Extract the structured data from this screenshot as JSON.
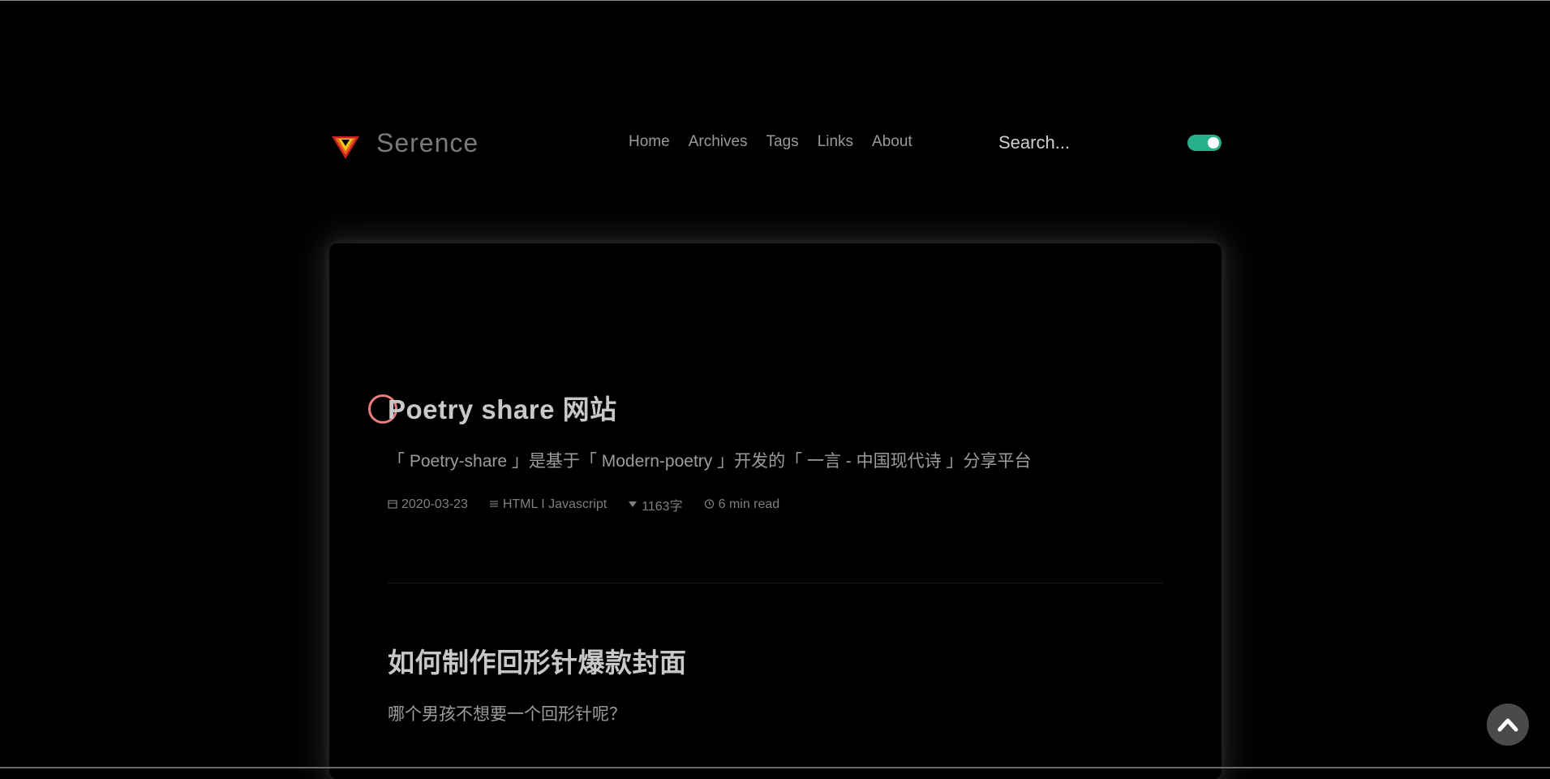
{
  "brand": {
    "name": "Serence",
    "logo_icon": "triangle-logo-icon",
    "logo_colors": [
      "#f5c518",
      "#e8641e",
      "#c42020"
    ]
  },
  "nav": {
    "items": [
      {
        "label": "Home"
      },
      {
        "label": "Archives"
      },
      {
        "label": "Tags"
      },
      {
        "label": "Links"
      },
      {
        "label": "About"
      }
    ]
  },
  "search": {
    "placeholder": "Search..."
  },
  "theme_toggle": {
    "state": "on",
    "color": "#27b08c"
  },
  "posts": [
    {
      "title": "Poetry share 网站",
      "description": "「 Poetry-share 」是基于「 Modern-poetry 」开发的「 一言 - 中国现代诗 」分享平台",
      "date": "2020-03-23",
      "categories": "HTML I Javascript",
      "word_count": "1163字",
      "read_time": "6 min read"
    },
    {
      "title": "如何制作回形针爆款封面",
      "description": "哪个男孩不想要一个回形针呢？"
    }
  ],
  "back_to_top": {
    "icon": "chevron-up-icon"
  }
}
